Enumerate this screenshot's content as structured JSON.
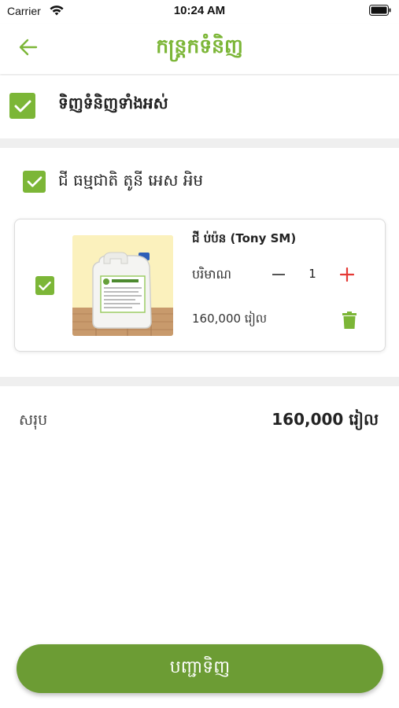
{
  "status_bar": {
    "carrier": "Carrier",
    "time": "10:24 AM"
  },
  "header": {
    "title": "កន្ត្រកទំនិញ",
    "back_icon": "arrow-left-icon"
  },
  "select_all": {
    "label": "ទិញទំនិញទាំងអស់",
    "checked": true
  },
  "shop": {
    "name": "ជី ធម្មជាតិ តូនី អេស អិម",
    "checked": true
  },
  "items": [
    {
      "name": "ជី ប់ប៉ន (Tony SM)",
      "quantity_label": "បរិមាណ",
      "quantity": "1",
      "price": "160,000 រៀល",
      "checked": true,
      "image_label": "10L"
    }
  ],
  "summary": {
    "total_label": "សរុប",
    "total_value": "160,000 រៀល"
  },
  "order_button": {
    "label": "បញ្ជាទិញ"
  },
  "colors": {
    "accent": "#7cb637",
    "button": "#6c9c34",
    "plus": "#e53935",
    "divider": "#efefef"
  }
}
